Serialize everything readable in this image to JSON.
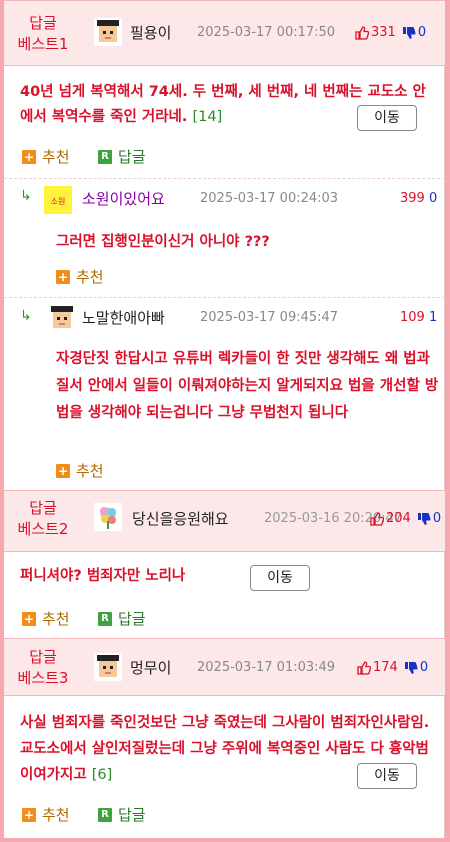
{
  "best1": {
    "label": "답글\n베스트1",
    "nick": "필용이",
    "date": "2025-03-17 00:17:50",
    "up": "331",
    "down": "0",
    "text": "40년 넘게 복역해서 74세. 두 번째, 세 번째, 네 번째는 교도소 안에서 복역수를 죽인 거라네.",
    "reply_count": "[14]",
    "move": "이동",
    "recommend": "추천",
    "reply": "답글"
  },
  "sub1": {
    "nick": "소원이있어요",
    "date": "2025-03-17 00:24:03",
    "up": "399",
    "down": "0",
    "text": "그러면 집행인분이신거 아니야 ???",
    "recommend": "추천"
  },
  "sub2": {
    "nick": "노말한애아빠",
    "date": "2025-03-17 09:45:47",
    "up": "109",
    "down": "1",
    "text": "자경단짓 한답시고 유튜버 렉카들이 한 짓만 생각해도 왜 법과 질서 안에서 일들이 이뤄져야하는지 알게되지요 법을 개선할 방법을 생각해야 되는겁니다 그냥 무법천지 됩니다",
    "recommend": "추천"
  },
  "best2": {
    "label": "답글\n베스트2",
    "nick": "당신을응원해요",
    "date": "2025-03-16 20:20:47",
    "up": "204",
    "down": "0",
    "text": "퍼니셔야? 범죄자만 노리나",
    "move": "이동",
    "recommend": "추천",
    "reply": "답글"
  },
  "best3": {
    "label": "답글\n베스트3",
    "nick": "멍무이",
    "date": "2025-03-17 01:03:49",
    "up": "174",
    "down": "0",
    "text": "사실 범죄자를 죽인것보단 그냥 죽였는데 그사람이 범죄자인사람임. 교도소에서 살인저질렀는데 그냥 주위에 복역중인 사람도 다 흉악범이여가지고",
    "reply_count": "[6]",
    "move": "이동",
    "recommend": "추천",
    "reply": "답글"
  },
  "icons": {
    "thumb_up": "thumb-up-icon",
    "thumb_down": "thumb-down-icon",
    "plus": "plus-icon",
    "reply_box": "reply-r-icon",
    "reply_arrow": "reply-arrow-icon"
  },
  "colors": {
    "accent_red": "#d9112b",
    "down_blue": "#1533c8",
    "recommend_orange": "#f08d1b",
    "reply_green": "#3ea33e",
    "border_pink": "#f6a8ae"
  }
}
